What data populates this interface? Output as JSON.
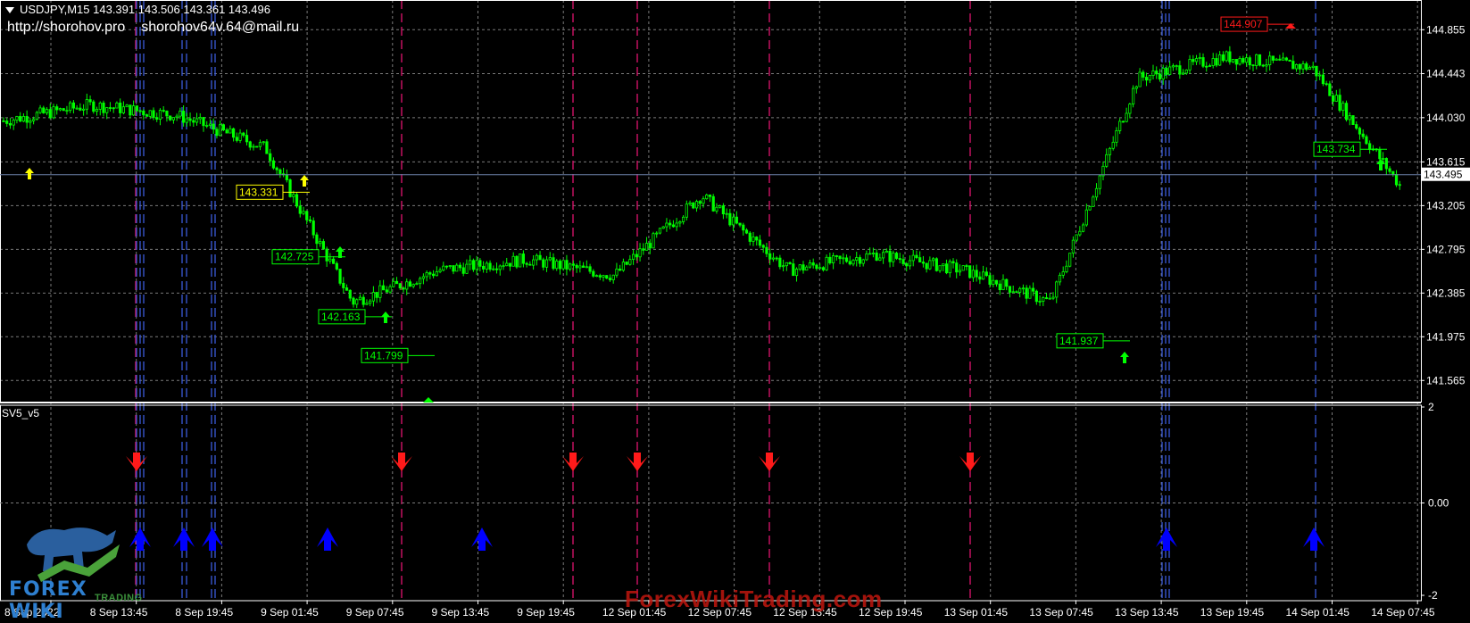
{
  "header": {
    "symbol_line": "USDJPY,M15  143.391 143.506 143.361 143.496",
    "site": "http://shorohov.pro",
    "email": "shorohov64v.64@mail.ru"
  },
  "indicator": {
    "name": "SV5_v5"
  },
  "watermark": {
    "text": "ForexWikiTrading.com"
  },
  "logo": {
    "brand": "FOREX WIKI",
    "sub": "TRADING"
  },
  "colors": {
    "background": "#000000",
    "grid": "#7a7a7a",
    "candle": "#00ff00",
    "sell_arrow": "#ff1a1a",
    "buy_arrow": "#0000ff",
    "vline_red": "#e0146e",
    "vline_blue": "#3b5bd9",
    "current_price_line": "#6a7fa8"
  },
  "chart_data": {
    "type": "line",
    "symbol": "USDJPY",
    "timeframe": "M15",
    "x": [
      "8 Sep 2022",
      "8 Sep 13:45",
      "8 Sep 19:45",
      "9 Sep 01:45",
      "9 Sep 07:45",
      "9 Sep 13:45",
      "9 Sep 19:45",
      "12 Sep 01:45",
      "12 Sep 07:45",
      "12 Sep 13:45",
      "12 Sep 19:45",
      "13 Sep 01:45",
      "13 Sep 07:45",
      "13 Sep 13:45",
      "13 Sep 19:45",
      "14 Sep 01:45",
      "14 Sep 07:45"
    ],
    "x_ticks": [
      "8 Sep 2022",
      "8 Sep 13:45",
      "8 Sep 19:45",
      "9 Sep 01:45",
      "9 Sep 07:45",
      "9 Sep 13:45",
      "9 Sep 19:45",
      "12 Sep 01:45",
      "12 Sep 07:45",
      "12 Sep 13:45",
      "12 Sep 19:45",
      "13 Sep 01:45",
      "13 Sep 07:45",
      "13 Sep 13:45",
      "13 Sep 19:45",
      "14 Sep 01:45",
      "14 Sep 07:45"
    ],
    "y_ticks": [
      "144.855",
      "144.443",
      "144.030",
      "143.615",
      "143.205",
      "142.795",
      "142.385",
      "141.975",
      "141.565"
    ],
    "current_price": "143.495",
    "ylim": [
      141.45,
      145.05
    ],
    "price_path": [
      {
        "x": "8 Sep 2022",
        "close": 144.0
      },
      {
        "x": "8 Sep 13:45",
        "close": 144.15
      },
      {
        "x": "8 Sep 19:45",
        "close": 144.05
      },
      {
        "x": "9 Sep 01:45",
        "close": 143.75
      },
      {
        "x": "9 Sep 07:45",
        "close": 142.3
      },
      {
        "x": "9 Sep 13:45",
        "close": 142.6
      },
      {
        "x": "9 Sep 19:45",
        "close": 142.7
      },
      {
        "x": "12 Sep 01:45",
        "close": 142.55
      },
      {
        "x": "12 Sep 07:45",
        "close": 143.3
      },
      {
        "x": "12 Sep 13:45",
        "close": 142.6
      },
      {
        "x": "12 Sep 19:45",
        "close": 142.75
      },
      {
        "x": "13 Sep 01:45",
        "close": 142.6
      },
      {
        "x": "13 Sep 07:45",
        "close": 142.3
      },
      {
        "x": "13 Sep 13:45",
        "close": 144.4
      },
      {
        "x": "13 Sep 19:45",
        "close": 144.6
      },
      {
        "x": "14 Sep 01:45",
        "close": 144.5
      },
      {
        "x": "14 Sep 07:45",
        "close": 143.4
      }
    ],
    "level_labels": [
      {
        "text": "143.331",
        "color": "#ffff00",
        "price": 143.331
      },
      {
        "text": "142.725",
        "color": "#00ff00",
        "price": 142.725
      },
      {
        "text": "142.163",
        "color": "#00ff00",
        "price": 142.163
      },
      {
        "text": "141.799",
        "color": "#00ff00",
        "price": 141.799
      },
      {
        "text": "141.937",
        "color": "#00ff00",
        "price": 141.937
      },
      {
        "text": "143.734",
        "color": "#00ff00",
        "price": 143.734
      },
      {
        "text": "144.907",
        "color": "#ff1a1a",
        "price": 144.907
      }
    ],
    "indicator": {
      "name": "SV5_v5",
      "y_ticks": [
        "2",
        "0.00",
        "-2"
      ],
      "ylim": [
        -2,
        2
      ],
      "sell_signals": 7,
      "buy_signals": 7
    }
  }
}
